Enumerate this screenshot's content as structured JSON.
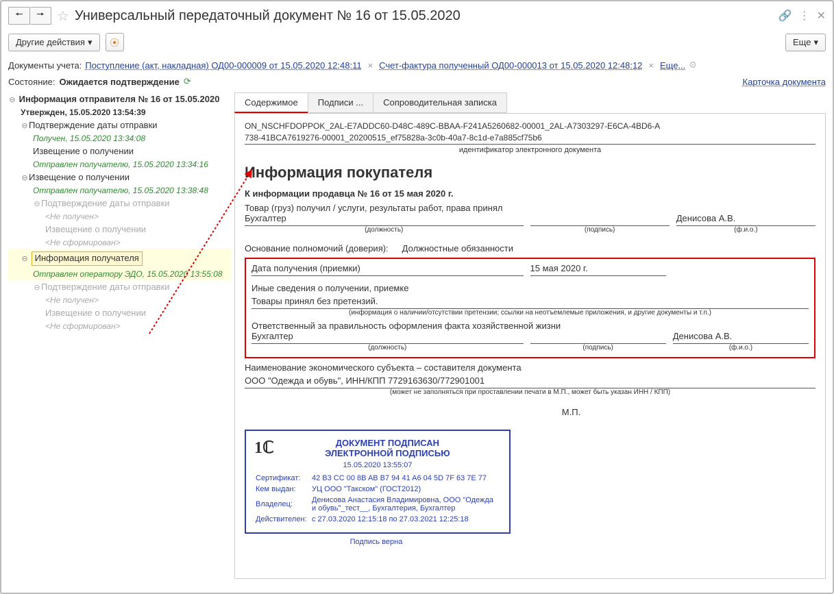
{
  "titlebar": {
    "page_title": "Универсальный передаточный документ № 16 от 15.05.2020"
  },
  "toolbar": {
    "other_actions": "Другие действия",
    "more": "Еще"
  },
  "accounting_docs": {
    "label": "Документы учета:",
    "link1": "Поступление (акт, накладная) ОД00-000009 от 15.05.2020 12:48:11",
    "link2": "Счет-фактура полученный ОД00-000013 от 15.05.2020 12:48:12",
    "more": "Еще..."
  },
  "status_row": {
    "label": "Состояние:",
    "value": "Ожидается подтверждение"
  },
  "card_link": "Карточка документа",
  "tree": {
    "root": "Информация отправителя № 16 от 15.05.2020",
    "root_status": "Утвержден, 15.05.2020 13:54:39",
    "n1": "Подтверждение даты отправки",
    "n1s": "Получен, 15.05.2020 13:34:08",
    "n2": "Извещение о получении",
    "n2s": "Отправлен получателю, 15.05.2020 13:34:16",
    "n3": "Извещение о получении",
    "n3s": "Отправлен получателю, 15.05.2020 13:38:48",
    "n4": "Подтверждение даты отправки",
    "n4s": "<Не получен>",
    "n5": "Извещение о получении",
    "n5s": "<Не сформирован>",
    "n6": "Информация получателя",
    "n6s": "Отправлен оператору ЭДО, 15.05.2020 13:55:08",
    "n7": "Подтверждение даты отправки",
    "n7s": "<Не получен>",
    "n8": "Извещение о получении",
    "n8s": "<Не сформирован>"
  },
  "tabs": {
    "content": "Содержимое",
    "signatures": "Подписи ...",
    "cover": "Сопроводительная записка"
  },
  "doc": {
    "id_line1": "ON_NSCHFDOPPOK_2AL-E7ADDC60-D48C-489C-BBAA-F241A5260682-00001_2AL-A7303297-E6CA-4BD6-A",
    "id_line2": "738-41BCA7619276-00001_20200515_ef75828a-3c0b-40a7-8c1d-e7a885cf75b6",
    "id_caption": "идентификатор электронного документа",
    "section_title": "Информация покупателя",
    "ref": "К информации продавца № 16 от 15 мая 2020 г.",
    "received_label": "Товар (груз) получил / услуги, результаты работ, права принял",
    "position1": "Бухгалтер",
    "fio1": "Денисова А.В.",
    "cap_pos": "(должность)",
    "cap_sign": "(подпись)",
    "cap_fio": "(ф.и.о.)",
    "basis_label": "Основание полномочий (доверия):",
    "basis_value": "Должностные обязанности",
    "date_label": "Дата получения (приемки)",
    "date_value": "15 мая 2020 г.",
    "other_label": "Иные сведения о получении, приемке",
    "other_value": "Товары принял без претензий.",
    "other_note": "(информация о наличии/отсутствии претензии; ссылки на неотъемлемые приложения, и другие  документы и т.п.)",
    "resp_label": "Ответственный за правильность оформления факта хозяйственной жизни",
    "position2": "Бухгалтер",
    "fio2": "Денисова А.В.",
    "subject_label": "Наименование экономического субъекта – составителя документа",
    "subject_value": "ООО \"Одежда и обувь\", ИНН/КПП 7729163630/772901001",
    "subject_note": "(может не заполняться при проставлении печати в М.П., может быть указан ИНН / КПП)",
    "mp": "М.П."
  },
  "sign": {
    "title1": "ДОКУМЕНТ ПОДПИСАН",
    "title2": "ЭЛЕКТРОННОЙ ПОДПИСЬЮ",
    "ts": "15.05.2020 13:55:07",
    "cert_label": "Сертификат:",
    "cert_value": "42 B3 CC 00 8B AB B7 94 41 A6 04 5D 7F 63 7E 77",
    "issued_label": "Кем выдан:",
    "issued_value": "УЦ ООО \"Такском\" (ГОСТ2012)",
    "owner_label": "Владелец:",
    "owner_value": "Денисова Анастасия Владимировна, ООО \"Одежда и обувь\"_тест__, Бухгалтерия, Бухгалтер",
    "valid_label": "Действителен:",
    "valid_value": "с 27.03.2020 12:15:18 по 27.03.2021 12:25:18",
    "valid": "Подпись верна"
  }
}
